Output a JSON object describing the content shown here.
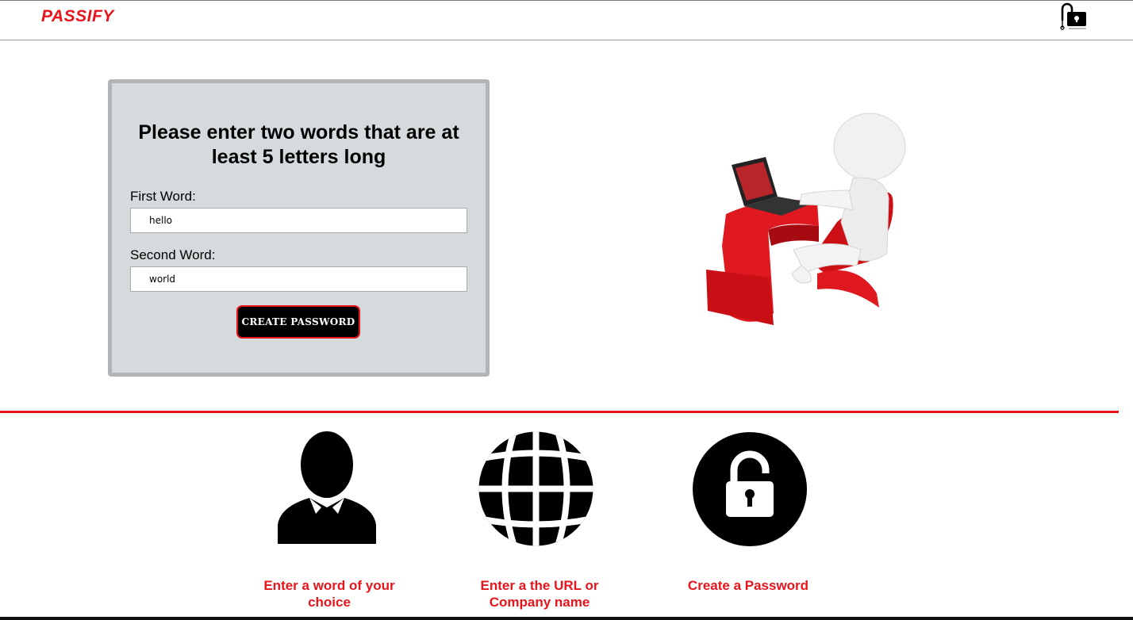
{
  "header": {
    "brand": "PASSIFY",
    "lock_icon": "unlocked-padlock-icon"
  },
  "form": {
    "title": "Please enter two words that are at least 5 letters long",
    "first_label": "First Word:",
    "first_value": "hello",
    "second_label": "Second Word:",
    "second_value": "world",
    "button_label": "CREATE PASSWORD"
  },
  "hero": {
    "image": "3d-figure-at-laptop-illustration"
  },
  "features": [
    {
      "icon": "person-icon",
      "text": "Enter a word of your choice"
    },
    {
      "icon": "globe-icon",
      "text": "Enter a the URL or Company name"
    },
    {
      "icon": "padlock-icon",
      "text": "Create a Password"
    }
  ],
  "colors": {
    "accent": "#e8141c",
    "card_bg": "#d5dbdd",
    "card_border": "#b1b5b7",
    "button_bg": "#000000"
  }
}
